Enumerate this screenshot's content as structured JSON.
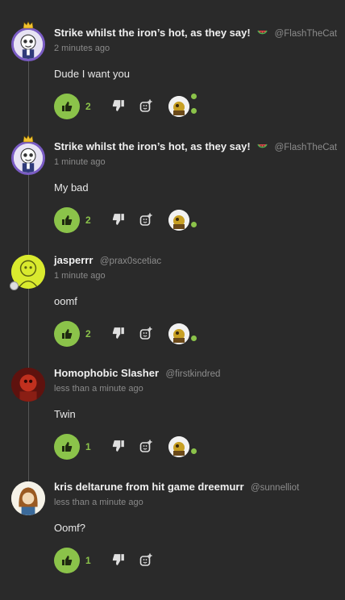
{
  "colors": {
    "background": "#2a2a2a",
    "accent": "#8bc34a",
    "muted": "#8a8a8a"
  },
  "comments": [
    {
      "author": "Strike whilst the iron’s hot, as they say!",
      "emoji": "watermelon-icon",
      "handle": "@FlashTheCat",
      "time": "2 minutes ago",
      "text": "Dude I want you",
      "likes": "2"
    },
    {
      "author": "Strike whilst the iron’s hot, as they say!",
      "emoji": "watermelon-icon",
      "handle": "@FlashTheCat",
      "time": "1 minute ago",
      "text": "My bad",
      "likes": "2"
    },
    {
      "author": "jasperrr",
      "handle": "@prax0scetiac",
      "time": "1 minute ago",
      "text": "oomf",
      "likes": "2"
    },
    {
      "author": "Homophobic Slasher",
      "handle": "@firstkindred",
      "time": "less than a minute ago",
      "text": "Twin",
      "likes": "1"
    },
    {
      "author": "kris deltarune from hit game dreemurr",
      "handle": "@sunnelliot",
      "time": "less than a minute ago",
      "text": "Oomf?",
      "likes": "1"
    }
  ]
}
